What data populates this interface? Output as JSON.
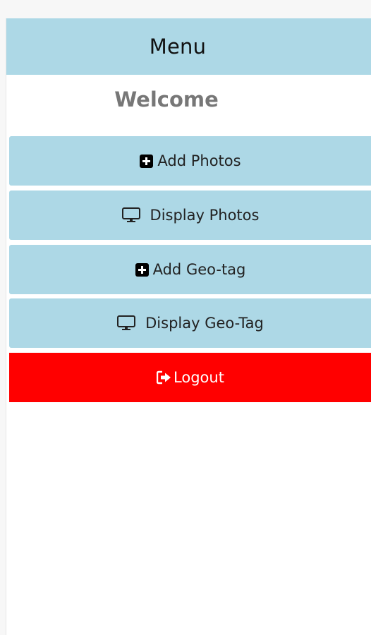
{
  "header": {
    "title": "Menu"
  },
  "welcome": "Welcome",
  "menu": {
    "add_photos": {
      "label": "Add Photos",
      "icon": "plus-square-icon"
    },
    "display_photos": {
      "label": "Display Photos",
      "icon": "monitor-icon"
    },
    "add_geotag": {
      "label": "Add Geo-tag",
      "icon": "plus-square-icon"
    },
    "display_geotag": {
      "label": "Display Geo-Tag",
      "icon": "monitor-icon"
    },
    "logout": {
      "label": "Logout",
      "icon": "sign-out-icon"
    }
  },
  "colors": {
    "menu_bg": "#add8e6",
    "logout_bg": "#ff0000",
    "welcome_text": "#777777"
  }
}
